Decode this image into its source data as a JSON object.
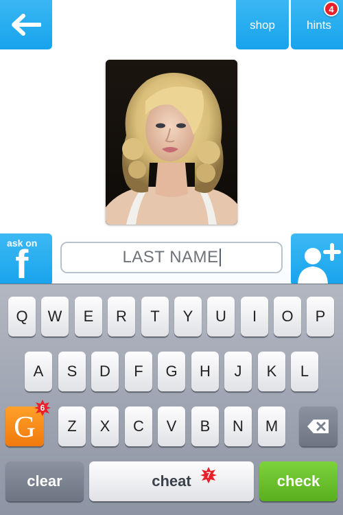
{
  "header": {
    "back_icon": "arrow-left-icon",
    "shop_label": "shop",
    "hints_label": "hints",
    "hints_count": "4"
  },
  "photo": {
    "description_icon": "celebrity-portrait"
  },
  "social": {
    "ask_label": "ask on",
    "facebook_letter": "f",
    "add_friend_icon": "add-person-icon"
  },
  "answer": {
    "value": "LAST NAME"
  },
  "keyboard": {
    "row1": [
      "Q",
      "W",
      "E",
      "R",
      "T",
      "Y",
      "U",
      "I",
      "O",
      "P"
    ],
    "row2": [
      "A",
      "S",
      "D",
      "F",
      "G",
      "H",
      "J",
      "K",
      "L"
    ],
    "row3": [
      "Z",
      "X",
      "C",
      "V",
      "B",
      "N",
      "M"
    ],
    "g_letter": "G",
    "g_count": "6",
    "backspace_icon": "backspace-icon",
    "clear_label": "clear",
    "cheat_label": "cheat",
    "cheat_count": "7",
    "check_label": "check"
  },
  "colors": {
    "accent_blue": "#1aa6ee",
    "check_green": "#5cb320",
    "badge_red": "#e8202a",
    "g_orange": "#f5870f"
  }
}
